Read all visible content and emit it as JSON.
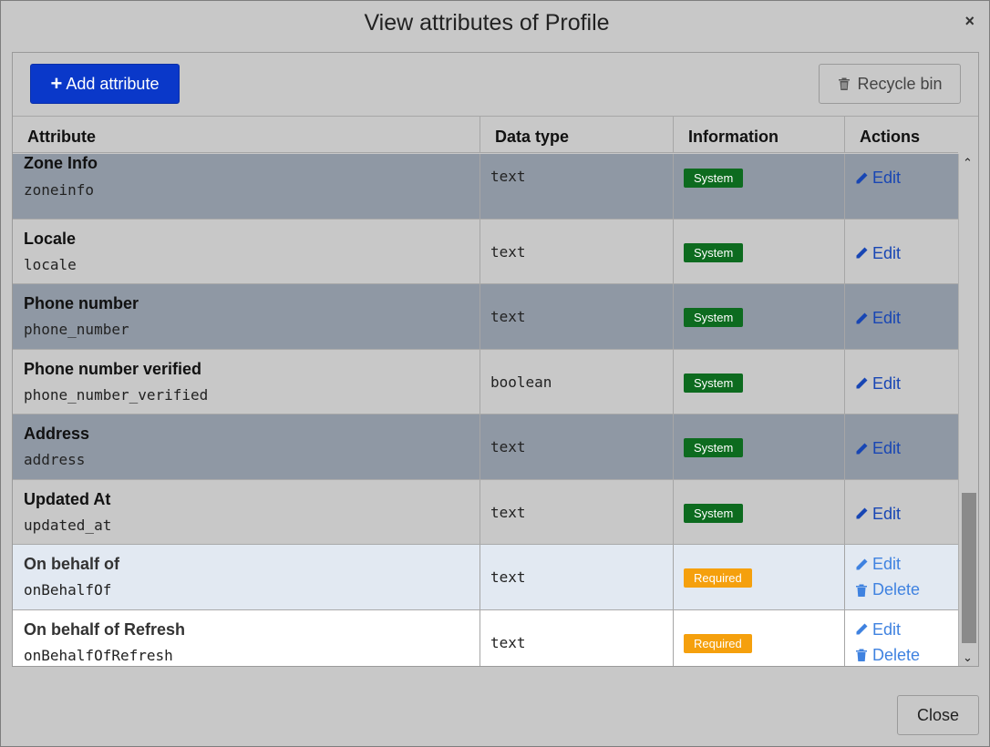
{
  "dialog": {
    "title": "View attributes of Profile",
    "close_icon": "×"
  },
  "toolbar": {
    "add_label": "Add attribute",
    "recycle_label": "Recycle bin"
  },
  "table": {
    "headers": [
      "Attribute",
      "Data type",
      "Information",
      "Actions"
    ],
    "rows": [
      {
        "name": "Zone Info",
        "key": "zoneinfo",
        "type": "text",
        "info": "System",
        "edit": "Edit"
      },
      {
        "name": "Locale",
        "key": "locale",
        "type": "text",
        "info": "System",
        "edit": "Edit"
      },
      {
        "name": "Phone number",
        "key": "phone_number",
        "type": "text",
        "info": "System",
        "edit": "Edit"
      },
      {
        "name": "Phone number verified",
        "key": "phone_number_verified",
        "type": "boolean",
        "info": "System",
        "edit": "Edit"
      },
      {
        "name": "Address",
        "key": "address",
        "type": "text",
        "info": "System",
        "edit": "Edit"
      },
      {
        "name": "Updated At",
        "key": "updated_at",
        "type": "text",
        "info": "System",
        "edit": "Edit"
      },
      {
        "name": "On behalf of",
        "key": "onBehalfOf",
        "type": "text",
        "info": "Required",
        "edit": "Edit",
        "delete": "Delete"
      },
      {
        "name": "On behalf of Refresh",
        "key": "onBehalfOfRefresh",
        "type": "text",
        "info": "Required",
        "edit": "Edit",
        "delete": "Delete"
      }
    ]
  },
  "footer": {
    "close_label": "Close"
  },
  "colors": {
    "primary": "#0a38c9",
    "system_badge": "#0d6b1f",
    "required_badge": "#f5a00d",
    "link": "#1846b4"
  }
}
